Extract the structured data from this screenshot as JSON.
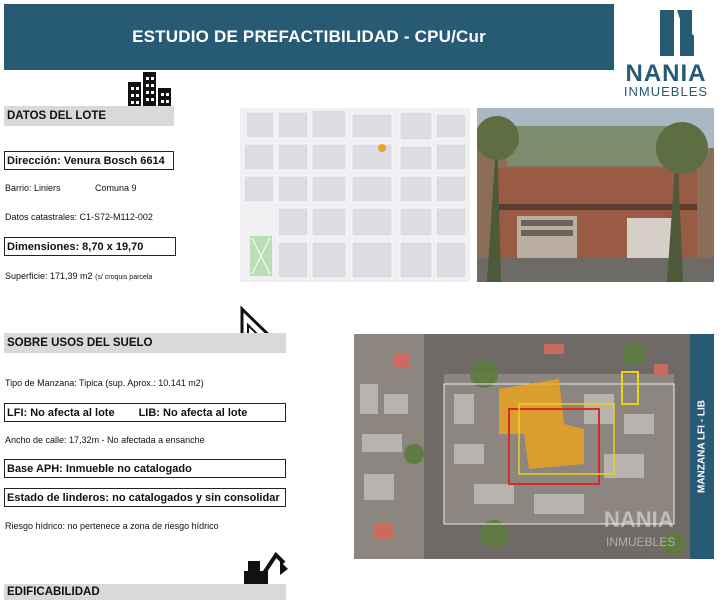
{
  "header": {
    "title": "ESTUDIO DE PREFACTIBILIDAD - CPU/Cur"
  },
  "logo": {
    "name": "NANIA",
    "sub": "INMUEBLES"
  },
  "colors": {
    "primary": "#275a74",
    "section_gray": "#d9d9d9",
    "lot_orange": "#f0a21a",
    "lot_yellow": "#e8d31a",
    "lot_red": "#d72b2b"
  },
  "datos_lote": {
    "heading": "DATOS DEL LOTE",
    "icon": "buildings-icon",
    "direccion": "Dirección: Venura Bosch 6614",
    "barrio": "Barrio: Liniers",
    "comuna": "Comuna 9",
    "catastrales": "Datos catastrales: C1-S72-M112-002",
    "dimensiones": "Dimensiones:  8,70 x 19,70",
    "superficie": "Superficie: 171,39 m2",
    "superficie_note": "(s/ croquis parcela"
  },
  "usos_suelo": {
    "heading": "SOBRE USOS DEL SUELO",
    "icon": "set-square-icon",
    "tipo_manzana": "Tipo de Manzana: Tipica (sup. Aprox.: 10.141 m2)",
    "lfi": "LFI: No afecta al lote",
    "lib": "LIB: No afecta al lote",
    "ancho_calle": "Ancho de calle: 17,32m  -  No afectada a ensanche",
    "base_aph": "Base APH: Inmueble no catalogado",
    "linderos": "Estado de linderos: no catalogados y sin consolidar",
    "riesgo": "Riesgo hídrico: no pertenece a zona de riesgo hídrico"
  },
  "edificabilidad": {
    "heading": "EDIFICABILIDAD",
    "icon": "excavator-icon"
  },
  "aerial": {
    "side_label": "MANZANA LFI - LIB",
    "watermark_name": "NANIA",
    "watermark_sub": "INMUEBLES"
  }
}
